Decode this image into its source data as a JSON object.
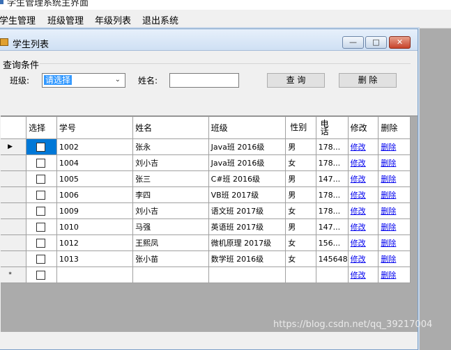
{
  "app": {
    "title": "学生管理系统主界面"
  },
  "menu": [
    {
      "label": "学生管理"
    },
    {
      "label": "班级管理"
    },
    {
      "label": "年级列表"
    },
    {
      "label": "退出系统"
    }
  ],
  "child_window": {
    "title": "学生列表",
    "buttons": {
      "minimize": "—",
      "maximize": "□",
      "close": "✕"
    }
  },
  "query": {
    "group_label": "查询条件",
    "class_label": "班级:",
    "class_selected": "请选择",
    "name_label": "姓名:",
    "name_value": "",
    "search_button": "查 询",
    "delete_button": "删 除"
  },
  "grid": {
    "headers": [
      "选择",
      "学号",
      "姓名",
      "班级",
      "性别",
      "电话",
      "修改",
      "删除"
    ],
    "rows": [
      {
        "indicator": "▶",
        "id": "1002",
        "name": "张永",
        "class": "Java班  2016级",
        "gender": "男",
        "phone": "178...",
        "edit": "修改",
        "del": "删除"
      },
      {
        "indicator": "",
        "id": "1004",
        "name": "刘小吉",
        "class": "Java班  2016级",
        "gender": "女",
        "phone": "178...",
        "edit": "修改",
        "del": "删除"
      },
      {
        "indicator": "",
        "id": "1005",
        "name": "张三",
        "class": "C#班  2016级",
        "gender": "男",
        "phone": "147...",
        "edit": "修改",
        "del": "删除"
      },
      {
        "indicator": "",
        "id": "1006",
        "name": "李四",
        "class": "VB班  2017级",
        "gender": "男",
        "phone": "178...",
        "edit": "修改",
        "del": "删除"
      },
      {
        "indicator": "",
        "id": "1009",
        "name": "刘小吉",
        "class": "语文班  2017级",
        "gender": "女",
        "phone": "178...",
        "edit": "修改",
        "del": "删除"
      },
      {
        "indicator": "",
        "id": "1010",
        "name": "马强",
        "class": "英语班  2017级",
        "gender": "男",
        "phone": "147...",
        "edit": "修改",
        "del": "删除"
      },
      {
        "indicator": "",
        "id": "1012",
        "name": "王熙凤",
        "class": "微机原理  2017级",
        "gender": "女",
        "phone": "156...",
        "edit": "修改",
        "del": "删除"
      },
      {
        "indicator": "",
        "id": "1013",
        "name": "张小苗",
        "class": "数学班  2016级",
        "gender": "女",
        "phone": "145648",
        "edit": "修改",
        "del": "删除"
      },
      {
        "indicator": "*",
        "id": "",
        "name": "",
        "class": "",
        "gender": "",
        "phone": "",
        "edit": "修改",
        "del": "删除"
      }
    ]
  },
  "watermark": "https://blog.csdn.net/qq_39217004",
  "colors": {
    "selection": "#3399ff",
    "link": "#0000ee",
    "desktop": "#ababab"
  }
}
